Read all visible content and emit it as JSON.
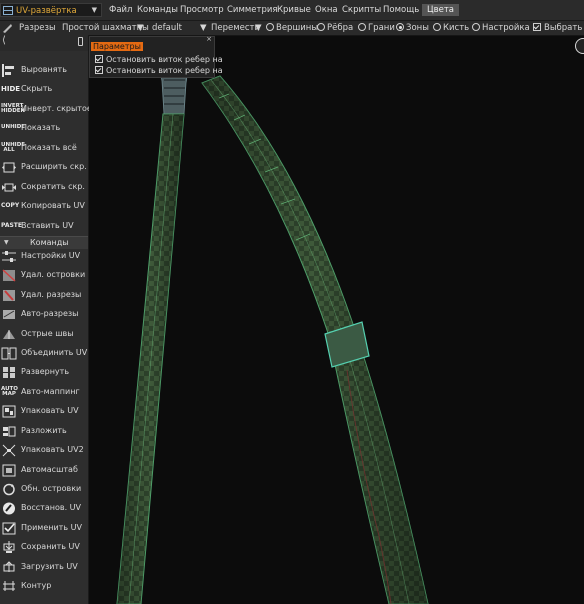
{
  "room": {
    "name": "UV-развёртка"
  },
  "menu": {
    "items": [
      "Файл",
      "Команды",
      "Просмотр",
      "Симметрия",
      "Кривые",
      "Окна",
      "Скрипты",
      "Помощь",
      "Цвета"
    ]
  },
  "toolbar": {
    "seams": "Разрезы",
    "checker": "Простой шахматны",
    "preset": "default",
    "move": "Перемести",
    "vertices": "Вершины",
    "edges": "Рёбра",
    "faces": "Грани",
    "zones": "Зоны",
    "brush": "Кисть",
    "settings": "Настройка",
    "select": "Выбрать"
  },
  "params_panel": {
    "title": "Параметры",
    "options": [
      "Остановить виток ребер на",
      "Остановить виток ребер на"
    ]
  },
  "sidebar": {
    "tools": [
      {
        "label": "Выровнять",
        "icon": "align-icon"
      },
      {
        "label": "Скрыть",
        "icon": "hide-icon",
        "tag": "HIDE"
      },
      {
        "label": "Инверт. скрытое",
        "icon": "invert-hidden-icon",
        "tag": "INVERT HIDDEN"
      },
      {
        "label": "Показать",
        "icon": "unhide-icon",
        "tag": "UNHIDE"
      },
      {
        "label": "Показать всё",
        "icon": "unhide-all-icon",
        "tag": "UNHIDE ALL"
      },
      {
        "label": "Расширить скр.",
        "icon": "expand-hidden-icon"
      },
      {
        "label": "Сократить скр.",
        "icon": "shrink-hidden-icon"
      },
      {
        "label": "Копировать UV",
        "icon": "copy-uv-icon",
        "tag": "COPY"
      },
      {
        "label": "Вставить UV",
        "icon": "paste-uv-icon",
        "tag": "PASTE"
      }
    ],
    "section_title": "Команды",
    "commands": [
      {
        "label": "Настройки UV",
        "icon": "uv-settings-icon"
      },
      {
        "label": "Удал. островки",
        "icon": "delete-islands-icon"
      },
      {
        "label": "Удал. разрезы",
        "icon": "delete-seams-icon"
      },
      {
        "label": "Авто-разрезы",
        "icon": "auto-seams-icon"
      },
      {
        "label": "Острые швы",
        "icon": "sharp-seams-icon"
      },
      {
        "label": "Объединить UV",
        "icon": "merge-uv-icon"
      },
      {
        "label": "Развернуть",
        "icon": "unwrap-icon"
      },
      {
        "label": "Авто-маппинг",
        "icon": "auto-mapping-icon",
        "tag": "AUTO MAP"
      },
      {
        "label": "Упаковать UV",
        "icon": "pack-uv-icon"
      },
      {
        "label": "Разложить",
        "icon": "layout-icon"
      },
      {
        "label": "Упаковать UV2",
        "icon": "pack-uv2-icon"
      },
      {
        "label": "Автомасштаб",
        "icon": "auto-scale-icon"
      },
      {
        "label": "Обн. островки",
        "icon": "update-islands-icon"
      },
      {
        "label": "Восстанов. UV",
        "icon": "restore-uv-icon"
      },
      {
        "label": "Применить UV",
        "icon": "apply-uv-icon"
      },
      {
        "label": "Сохранить UV",
        "icon": "save-uv-icon"
      },
      {
        "label": "Загрузить UV",
        "icon": "load-uv-icon"
      },
      {
        "label": "Контур",
        "icon": "contour-icon"
      }
    ]
  }
}
